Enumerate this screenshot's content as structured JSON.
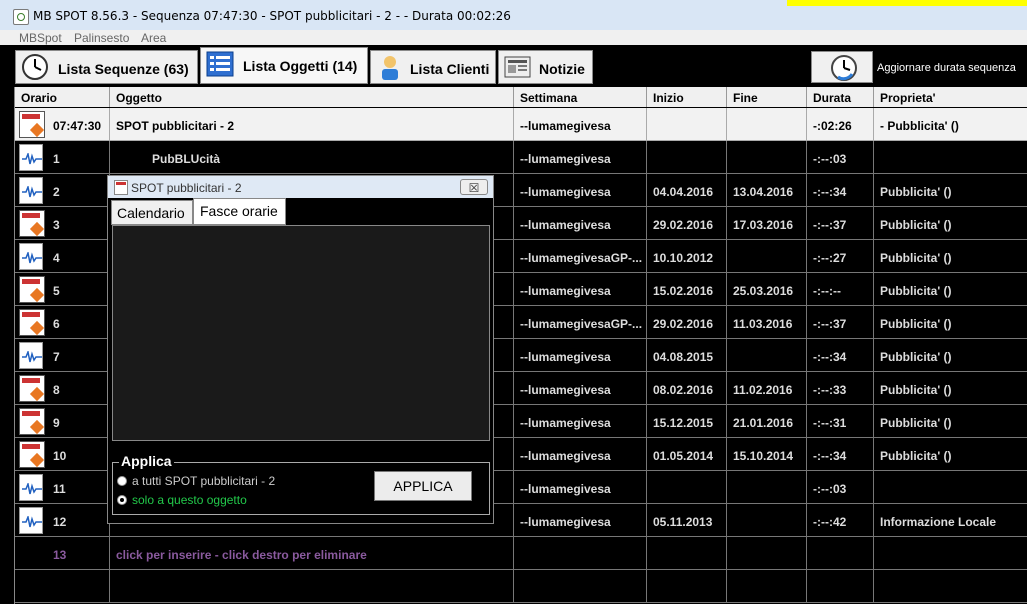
{
  "window": {
    "title": "MB SPOT 8.56.3 - Sequenza 07:47:30 - SPOT pubblicitari - 2 -  - Durata 00:02:26"
  },
  "menu": [
    "MBSpot",
    "Palinsesto",
    "Area"
  ],
  "tabs": [
    {
      "label": "Lista Sequenze (63)",
      "icon": "clock-icon"
    },
    {
      "label": "Lista Oggetti (14)",
      "icon": "list-icon"
    },
    {
      "label": "Lista Clienti",
      "icon": "person-icon"
    },
    {
      "label": "Notizie",
      "icon": "newspaper-icon"
    }
  ],
  "refresh": {
    "label": "Aggiornare durata sequenza"
  },
  "columns": [
    "Orario",
    "Oggetto",
    "Settimana",
    "Inizio",
    "Fine",
    "Durata",
    "Proprieta'"
  ],
  "rows": [
    {
      "orario": "07:47:30",
      "oggetto": "SPOT pubblicitari - 2",
      "settimana": "--lumamegivesa",
      "inizio": "",
      "fine": "",
      "durata": "-:02:26",
      "proprieta": " - Pubblicita' ()",
      "icon": "calendar-icon"
    },
    {
      "orario": "1",
      "oggetto": "PubBLUcità",
      "settimana": "--lumamegivesa",
      "inizio": "",
      "fine": "",
      "durata": "-:--:03",
      "proprieta": "",
      "icon": "audio-icon"
    },
    {
      "orario": "2",
      "oggetto": "",
      "settimana": "--lumamegivesa",
      "inizio": "04.04.2016",
      "fine": "13.04.2016",
      "durata": "-:--:34",
      "proprieta": "Pubblicita' ()",
      "icon": "audio-icon"
    },
    {
      "orario": "3",
      "oggetto": "",
      "settimana": "--lumamegivesa",
      "inizio": "29.02.2016",
      "fine": "17.03.2016",
      "durata": "-:--:37",
      "proprieta": "Pubblicita' ()",
      "icon": "calendar-icon"
    },
    {
      "orario": "4",
      "oggetto": "",
      "settimana": "--lumamegivesaGP-...",
      "inizio": "10.10.2012",
      "fine": "",
      "durata": "-:--:27",
      "proprieta": "Pubblicita' ()",
      "icon": "audio-icon"
    },
    {
      "orario": "5",
      "oggetto": "",
      "settimana": "--lumamegivesa",
      "inizio": "15.02.2016",
      "fine": "25.03.2016",
      "durata": "-:--:--",
      "proprieta": "Pubblicita' ()",
      "icon": "calendar-icon"
    },
    {
      "orario": "6",
      "oggetto": "",
      "settimana": "--lumamegivesaGP-...",
      "inizio": "29.02.2016",
      "fine": "11.03.2016",
      "durata": "-:--:37",
      "proprieta": "Pubblicita' ()",
      "icon": "calendar-icon"
    },
    {
      "orario": "7",
      "oggetto": "",
      "settimana": "--lumamegivesa",
      "inizio": "04.08.2015",
      "fine": "",
      "durata": "-:--:34",
      "proprieta": "Pubblicita' ()",
      "icon": "audio-icon"
    },
    {
      "orario": "8",
      "oggetto": "",
      "settimana": "--lumamegivesa",
      "inizio": "08.02.2016",
      "fine": "11.02.2016",
      "durata": "-:--:33",
      "proprieta": "Pubblicita' ()",
      "icon": "calendar-icon"
    },
    {
      "orario": "9",
      "oggetto": "",
      "settimana": "--lumamegivesa",
      "inizio": "15.12.2015",
      "fine": "21.01.2016",
      "durata": "-:--:31",
      "proprieta": "Pubblicita' ()",
      "icon": "calendar-icon"
    },
    {
      "orario": "10",
      "oggetto": "",
      "settimana": "--lumamegivesa",
      "inizio": "01.05.2014",
      "fine": "15.10.2014",
      "durata": "-:--:34",
      "proprieta": "Pubblicita' ()",
      "icon": "calendar-icon"
    },
    {
      "orario": "11",
      "oggetto": "",
      "settimana": "--lumamegivesa",
      "inizio": "",
      "fine": "",
      "durata": "-:--:03",
      "proprieta": "",
      "icon": "audio-icon"
    },
    {
      "orario": "12",
      "oggetto": "",
      "settimana": "--lumamegivesa",
      "inizio": "05.11.2013",
      "fine": "",
      "durata": "-:--:42",
      "proprieta": "Informazione Locale",
      "icon": "audio-icon"
    }
  ],
  "insert_row": {
    "num": "13",
    "text": "click per inserire - click destro per eliminare"
  },
  "dialog": {
    "title": "SPOT pubblicitari - 2",
    "close": "☒",
    "tabs": [
      "Calendario",
      "Fasce orarie"
    ],
    "group_label": "Applica",
    "option_all": "a tutti SPOT pubblicitari - 2",
    "option_this": "solo a questo oggetto",
    "apply_button": "APPLICA"
  },
  "colors": {
    "option_this": "#22c84a",
    "option_all": "#cccccc",
    "insert_row": "#8a5a9e"
  }
}
